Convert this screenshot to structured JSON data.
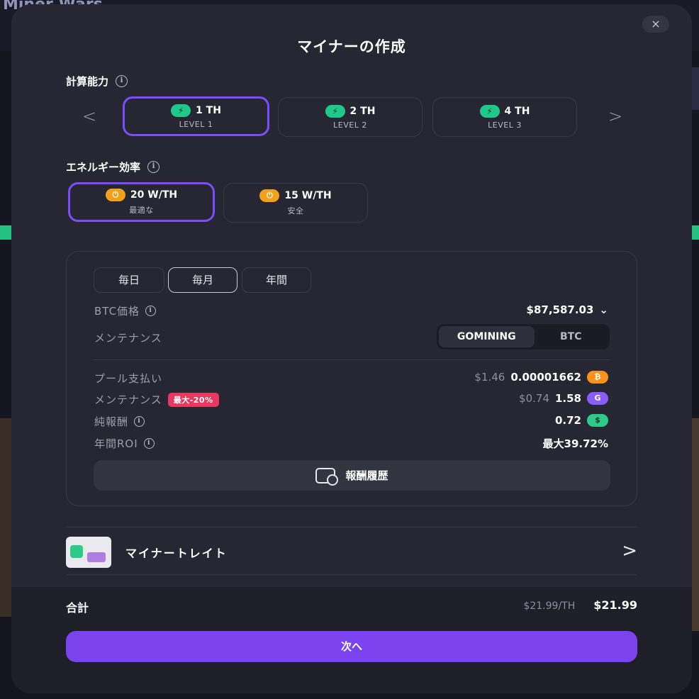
{
  "background": {
    "app_name": "Miner Wars"
  },
  "modal": {
    "title": "マイナーの作成",
    "close_icon": "×"
  },
  "hashpower": {
    "label": "計算能力",
    "prev_arrow": "<",
    "next_arrow": ">",
    "options": [
      {
        "value": "1 TH",
        "level": "LEVEL 1",
        "selected": true
      },
      {
        "value": "2 TH",
        "level": "LEVEL 2",
        "selected": false
      },
      {
        "value": "4 TH",
        "level": "LEVEL 3",
        "selected": false
      }
    ]
  },
  "energy": {
    "label": "エネルギー効率",
    "options": [
      {
        "value": "20 W/TH",
        "note": "最適な",
        "selected": true
      },
      {
        "value": "15 W/TH",
        "note": "安全",
        "selected": false
      }
    ]
  },
  "calculator": {
    "periods": [
      {
        "label": "毎日",
        "active": false
      },
      {
        "label": "毎月",
        "active": true
      },
      {
        "label": "年間",
        "active": false
      }
    ],
    "btc_price_label": "BTC価格",
    "btc_price_value": "$87,587.03",
    "maintenance_label": "メンテナンス",
    "maintenance_toggle": {
      "option1": "GOMINING",
      "option2": "BTC",
      "selected": "GOMINING"
    },
    "pool_label": "プール支払い",
    "pool_usd": "$1.46",
    "pool_btc": "0.00001662",
    "maint_cost_label": "メンテナンス",
    "maint_badge": "最大-20%",
    "maint_usd": "$0.74",
    "maint_value": "1.58",
    "net_label": "純報酬",
    "net_value": "0.72",
    "roi_label": "年間ROI",
    "roi_value": "最大39.72%",
    "history_button": "報酬履歴"
  },
  "tray": {
    "label": "マイナートレイト",
    "arrow": ">"
  },
  "footer": {
    "total_label": "合計",
    "per_th": "$21.99/TH",
    "total_value": "$21.99",
    "next_button": "次へ"
  },
  "colors": {
    "accent": "#7b43f0",
    "selected_border": "#7b4dff",
    "bolt": "#20c98a",
    "plug": "#f3a01b"
  }
}
